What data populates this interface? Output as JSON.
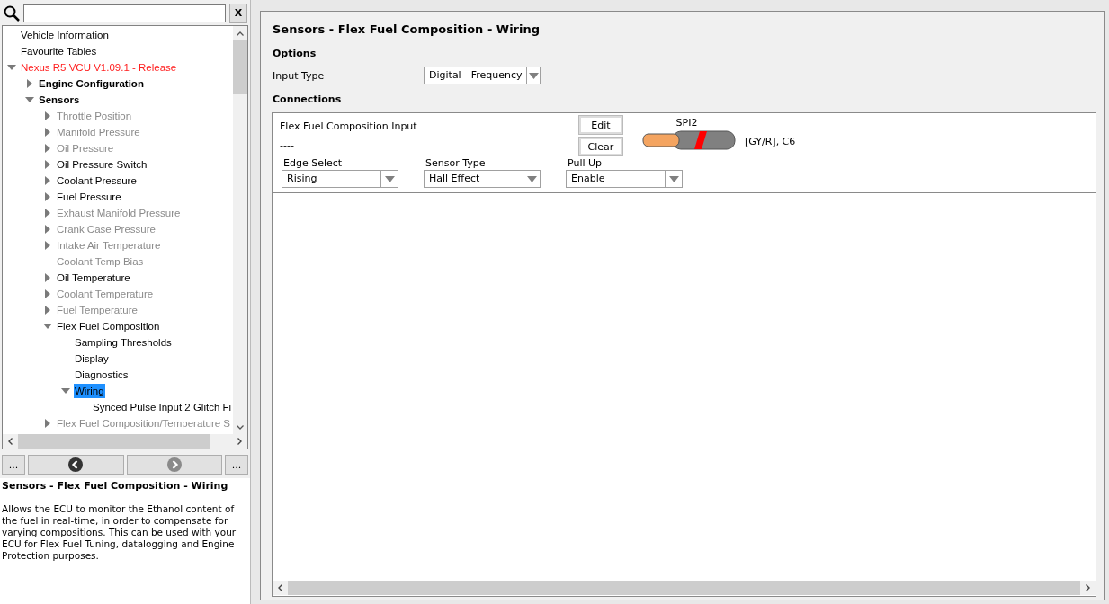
{
  "search": {
    "clear_label": "X"
  },
  "tree": [
    {
      "label": "Vehicle Information",
      "kind": "leaf",
      "enabled": true,
      "selected": false
    },
    {
      "label": "Favourite Tables",
      "kind": "leaf",
      "enabled": true,
      "selected": false
    },
    {
      "label": "Nexus R5 VCU V1.09.1 - Release",
      "kind": "device",
      "expanded": true,
      "enabled": true,
      "selected": false,
      "children": [
        {
          "label": "Engine Configuration",
          "kind": "group",
          "expanded": false,
          "enabled": true,
          "selected": false
        },
        {
          "label": "Sensors",
          "kind": "group",
          "expanded": true,
          "enabled": true,
          "selected": false,
          "children": [
            {
              "label": "Throttle Position",
              "kind": "branch",
              "expanded": false,
              "enabled": false,
              "selected": false
            },
            {
              "label": "Manifold Pressure",
              "kind": "branch",
              "expanded": false,
              "enabled": false,
              "selected": false
            },
            {
              "label": "Oil Pressure",
              "kind": "branch",
              "expanded": false,
              "enabled": false,
              "selected": false
            },
            {
              "label": "Oil Pressure Switch",
              "kind": "branch",
              "expanded": false,
              "enabled": true,
              "selected": false
            },
            {
              "label": "Coolant Pressure",
              "kind": "branch",
              "expanded": false,
              "enabled": true,
              "selected": false
            },
            {
              "label": "Fuel Pressure",
              "kind": "branch",
              "expanded": false,
              "enabled": true,
              "selected": false
            },
            {
              "label": "Exhaust Manifold Pressure",
              "kind": "branch",
              "expanded": false,
              "enabled": false,
              "selected": false
            },
            {
              "label": "Crank Case Pressure",
              "kind": "branch",
              "expanded": false,
              "enabled": false,
              "selected": false
            },
            {
              "label": "Intake Air Temperature",
              "kind": "branch",
              "expanded": false,
              "enabled": false,
              "selected": false
            },
            {
              "label": "Coolant Temp Bias",
              "kind": "leaf",
              "enabled": false,
              "selected": false
            },
            {
              "label": "Oil Temperature",
              "kind": "branch",
              "expanded": false,
              "enabled": true,
              "selected": false
            },
            {
              "label": "Coolant Temperature",
              "kind": "branch",
              "expanded": false,
              "enabled": false,
              "selected": false
            },
            {
              "label": "Fuel Temperature",
              "kind": "branch",
              "expanded": false,
              "enabled": false,
              "selected": false
            },
            {
              "label": "Flex Fuel Composition",
              "kind": "branch",
              "expanded": true,
              "enabled": true,
              "selected": false,
              "children": [
                {
                  "label": "Sampling Thresholds",
                  "kind": "leaf",
                  "enabled": true,
                  "selected": false
                },
                {
                  "label": "Display",
                  "kind": "leaf",
                  "enabled": true,
                  "selected": false
                },
                {
                  "label": "Diagnostics",
                  "kind": "leaf",
                  "enabled": true,
                  "selected": false
                },
                {
                  "label": "Wiring",
                  "kind": "branch",
                  "expanded": true,
                  "enabled": true,
                  "selected": true,
                  "children": [
                    {
                      "label": "Synced Pulse Input 2 Glitch Fi",
                      "kind": "leaf",
                      "enabled": true,
                      "selected": false
                    }
                  ]
                }
              ]
            },
            {
              "label": "Flex Fuel Composition/Temperature S",
              "kind": "branch",
              "expanded": false,
              "enabled": false,
              "selected": false
            }
          ]
        }
      ]
    }
  ],
  "nav": {
    "more_left": "...",
    "more_right": "...",
    "back_enabled": true,
    "forward_enabled": false
  },
  "help": {
    "title": "Sensors - Flex Fuel Composition - Wiring",
    "text": "Allows the ECU to monitor the Ethanol content of the fuel in real-time, in order to compensate for varying compositions. This can be used with your ECU for Flex Fuel Tuning, datalogging and Engine Protection purposes."
  },
  "page": {
    "title": "Sensors - Flex Fuel Composition - Wiring",
    "options_heading": "Options",
    "options": [
      {
        "label": "Input Type",
        "value": "Digital - Frequency"
      }
    ],
    "connections_heading": "Connections",
    "connection": {
      "name": "Flex Fuel Composition Input",
      "value": "----",
      "edit_label": "Edit",
      "clear_label": "Clear",
      "pin_name": "SPI2",
      "wire_code": "[GY/R], C6",
      "settings": [
        {
          "label": "Edge Select",
          "value": "Rising"
        },
        {
          "label": "Sensor Type",
          "value": "Hall Effect"
        },
        {
          "label": "Pull Up",
          "value": "Enable"
        }
      ]
    }
  }
}
